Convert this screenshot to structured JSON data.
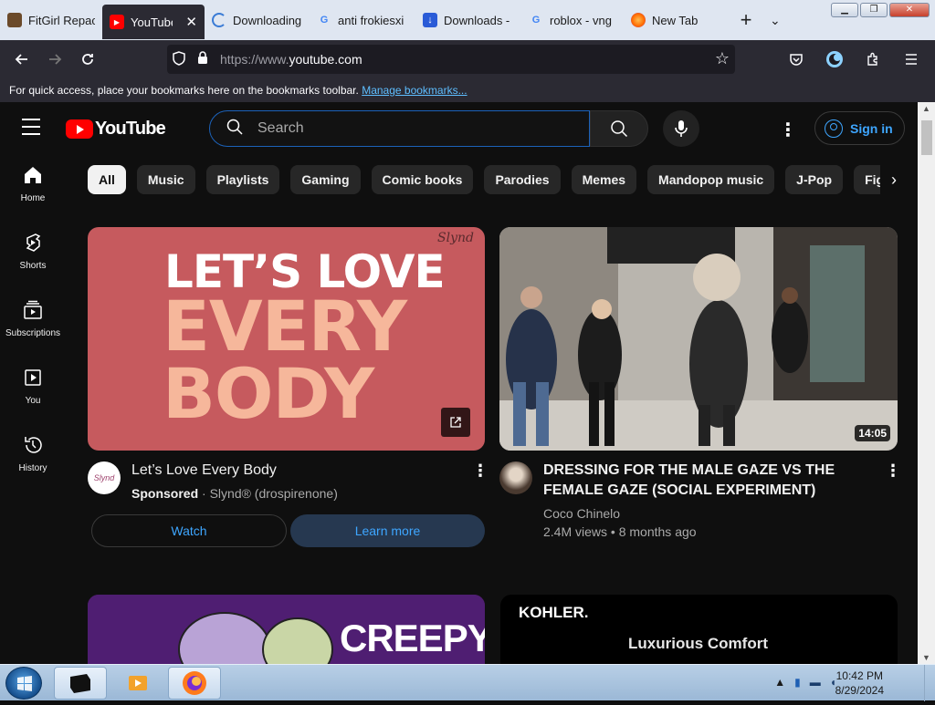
{
  "browser": {
    "tabs": [
      {
        "label": "FitGirl Repack",
        "icon": "fitgirl-favicon",
        "active": false
      },
      {
        "label": "YouTube",
        "icon": "youtube-favicon",
        "active": true
      },
      {
        "label": "Downloading",
        "icon": "loading-favicon",
        "active": false
      },
      {
        "label": "anti frokiesxi",
        "icon": "google-favicon",
        "active": false
      },
      {
        "label": "Downloads -",
        "icon": "downloads-favicon",
        "active": false
      },
      {
        "label": "roblox - vng",
        "icon": "google-favicon",
        "active": false
      },
      {
        "label": "New Tab",
        "icon": "firefox-favicon",
        "active": false
      }
    ],
    "url_prefix": "https://www.",
    "url_domain": "youtube.com",
    "bookmarks_text": "For quick access, place your bookmarks here on the bookmarks toolbar.",
    "bookmarks_link": "Manage bookmarks..."
  },
  "youtube": {
    "logo_text": "YouTube",
    "search_placeholder": "Search",
    "sign_in": "Sign in",
    "chips": [
      "All",
      "Music",
      "Playlists",
      "Gaming",
      "Comic books",
      "Parodies",
      "Memes",
      "Mandopop music",
      "J-Pop",
      "Fig"
    ],
    "sidebar": [
      {
        "label": "Home",
        "icon": "home-icon"
      },
      {
        "label": "Shorts",
        "icon": "shorts-icon"
      },
      {
        "label": "Subscriptions",
        "icon": "subscriptions-icon"
      },
      {
        "label": "You",
        "icon": "you-icon"
      },
      {
        "label": "History",
        "icon": "history-icon"
      }
    ],
    "ad": {
      "line1": "LET’S LOVE",
      "line2": "EVERY",
      "line3": "BODY",
      "brand": "Slynd",
      "title": "Let’s Love Every Body",
      "sponsored": "Sponsored",
      "advertiser": "Slynd® (drospirenone)",
      "avatar_text": "Slynd",
      "watch_label": "Watch",
      "learn_more_label": "Learn more"
    },
    "video": {
      "title": "DRESSING FOR THE MALE GAZE VS THE FEMALE GAZE (SOCIAL EXPERIMENT)",
      "channel": "Coco Chinelo",
      "views": "2.4M views",
      "age": "8 months ago",
      "duration": "14:05"
    },
    "row2": {
      "left_text": "CREEPY",
      "right_brand": "KOHLER.",
      "right_tagline": "Luxurious Comfort"
    }
  },
  "taskbar": {
    "time": "10:42 PM",
    "date": "8/29/2024"
  }
}
